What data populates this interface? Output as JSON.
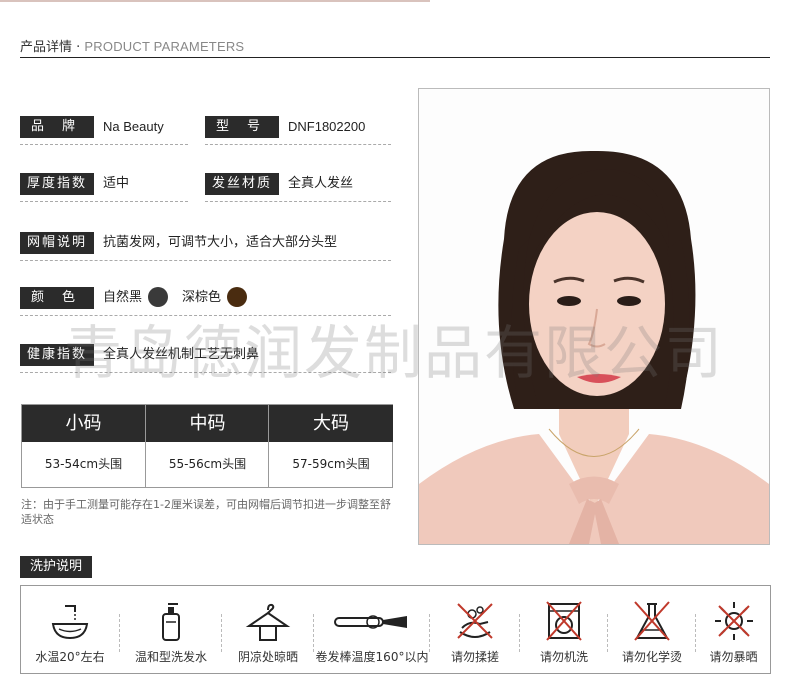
{
  "header": {
    "cn": "产品详情",
    "sep": " · ",
    "en": "PRODUCT PARAMETERS"
  },
  "params": {
    "brand_label": "品牌",
    "brand_value": "Na Beauty",
    "model_label": "型号",
    "model_value": "DNF1802200",
    "thickness_label": "厚度指数",
    "thickness_value": "适中",
    "material_label": "发丝材质",
    "material_value": "全真人发丝",
    "cap_label": "网帽说明",
    "cap_value": "抗菌发网，可调节大小，适合大部分头型",
    "color_label": "颜色",
    "color_1": "自然黑",
    "color_1_hex": "#3a3a3a",
    "color_2": "深棕色",
    "color_2_hex": "#4a2c10",
    "health_label": "健康指数",
    "health_value": "全真人发丝机制工艺无刺鼻"
  },
  "watermark": "青岛德润发制品有限公司",
  "sizes": [
    {
      "name": "小码",
      "range": "53-54cm头围"
    },
    {
      "name": "中码",
      "range": "55-56cm头围"
    },
    {
      "name": "大码",
      "range": "57-59cm头围"
    }
  ],
  "note": "注：由于手工测量可能存在1-2厘米误差，可由网帽后调节扣进一步调整至舒适状态",
  "care": {
    "title": "洗护说明",
    "items": [
      {
        "icon": "water-basin-icon",
        "label": "水温20°左右"
      },
      {
        "icon": "shampoo-bottle-icon",
        "label": "温和型洗发水"
      },
      {
        "icon": "hanger-dry-icon",
        "label": "阴凉处晾晒"
      },
      {
        "icon": "curling-iron-icon",
        "label": "卷发棒温度160°以内"
      },
      {
        "icon": "no-scrubbing-icon",
        "label": "请勿揉搓"
      },
      {
        "icon": "no-machine-wash-icon",
        "label": "请勿机洗"
      },
      {
        "icon": "no-chemical-perm-icon",
        "label": "请勿化学烫"
      },
      {
        "icon": "no-sun-exposure-icon",
        "label": "请勿暴晒"
      }
    ]
  },
  "colors": {
    "tag_bg": "#2b2b2b",
    "hair": "#2e1f18",
    "skin": "#f4d2c4",
    "blouse": "#f0c9bc"
  }
}
